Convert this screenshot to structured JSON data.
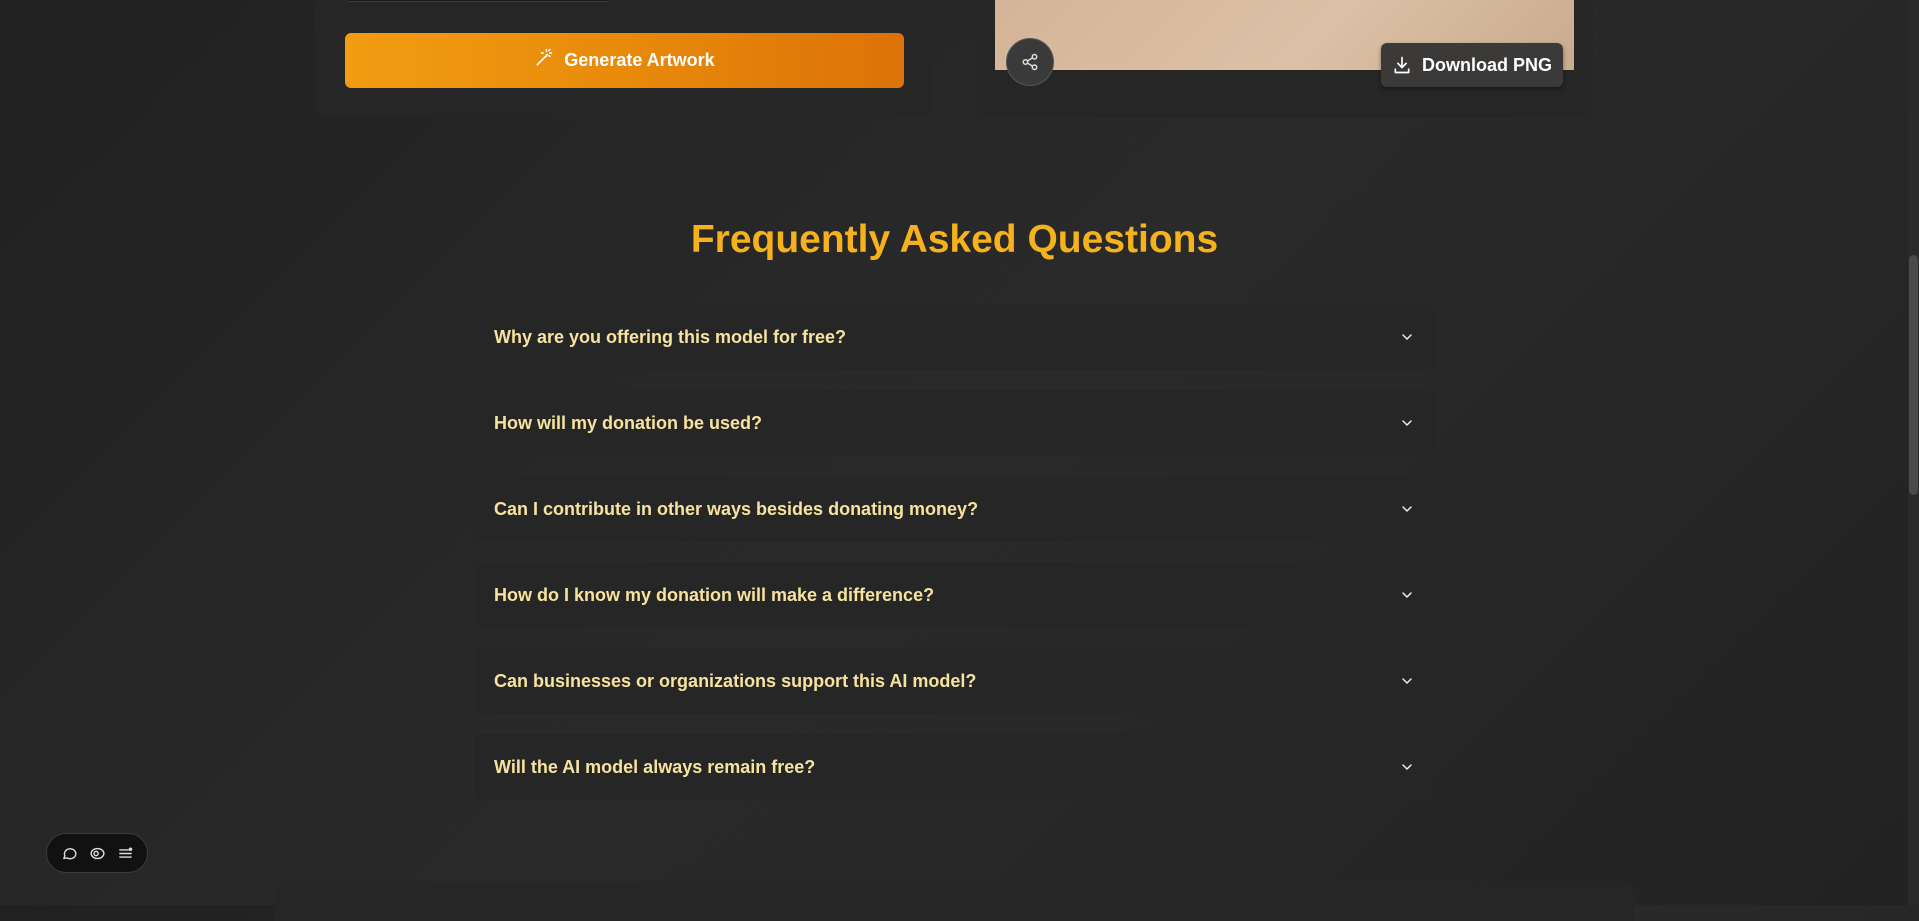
{
  "generator": {
    "generate_label": "Generate Artwork",
    "icon": "magic-wand-icon"
  },
  "preview": {
    "download_label": "Download PNG",
    "download_icon": "download-icon",
    "share_icon": "share-icon"
  },
  "faq": {
    "title": "Frequently Asked Questions",
    "items": [
      {
        "question": "Why are you offering this model for free?"
      },
      {
        "question": "How will my donation be used?"
      },
      {
        "question": "Can I contribute in other ways besides donating money?"
      },
      {
        "question": "How do I know my donation will make a difference?"
      },
      {
        "question": "Can businesses or organizations support this AI model?"
      },
      {
        "question": "Will the AI model always remain free?"
      }
    ]
  },
  "floating_toolbar": {
    "icons": [
      "chat-icon",
      "eye-icon",
      "list-menu-icon"
    ]
  },
  "colors": {
    "accent": "#f5b21d",
    "button_gradient_start": "#f29c12",
    "button_gradient_end": "#dc7208",
    "question_text": "#f6e3a0",
    "background": "#252525",
    "card": "#262626"
  }
}
